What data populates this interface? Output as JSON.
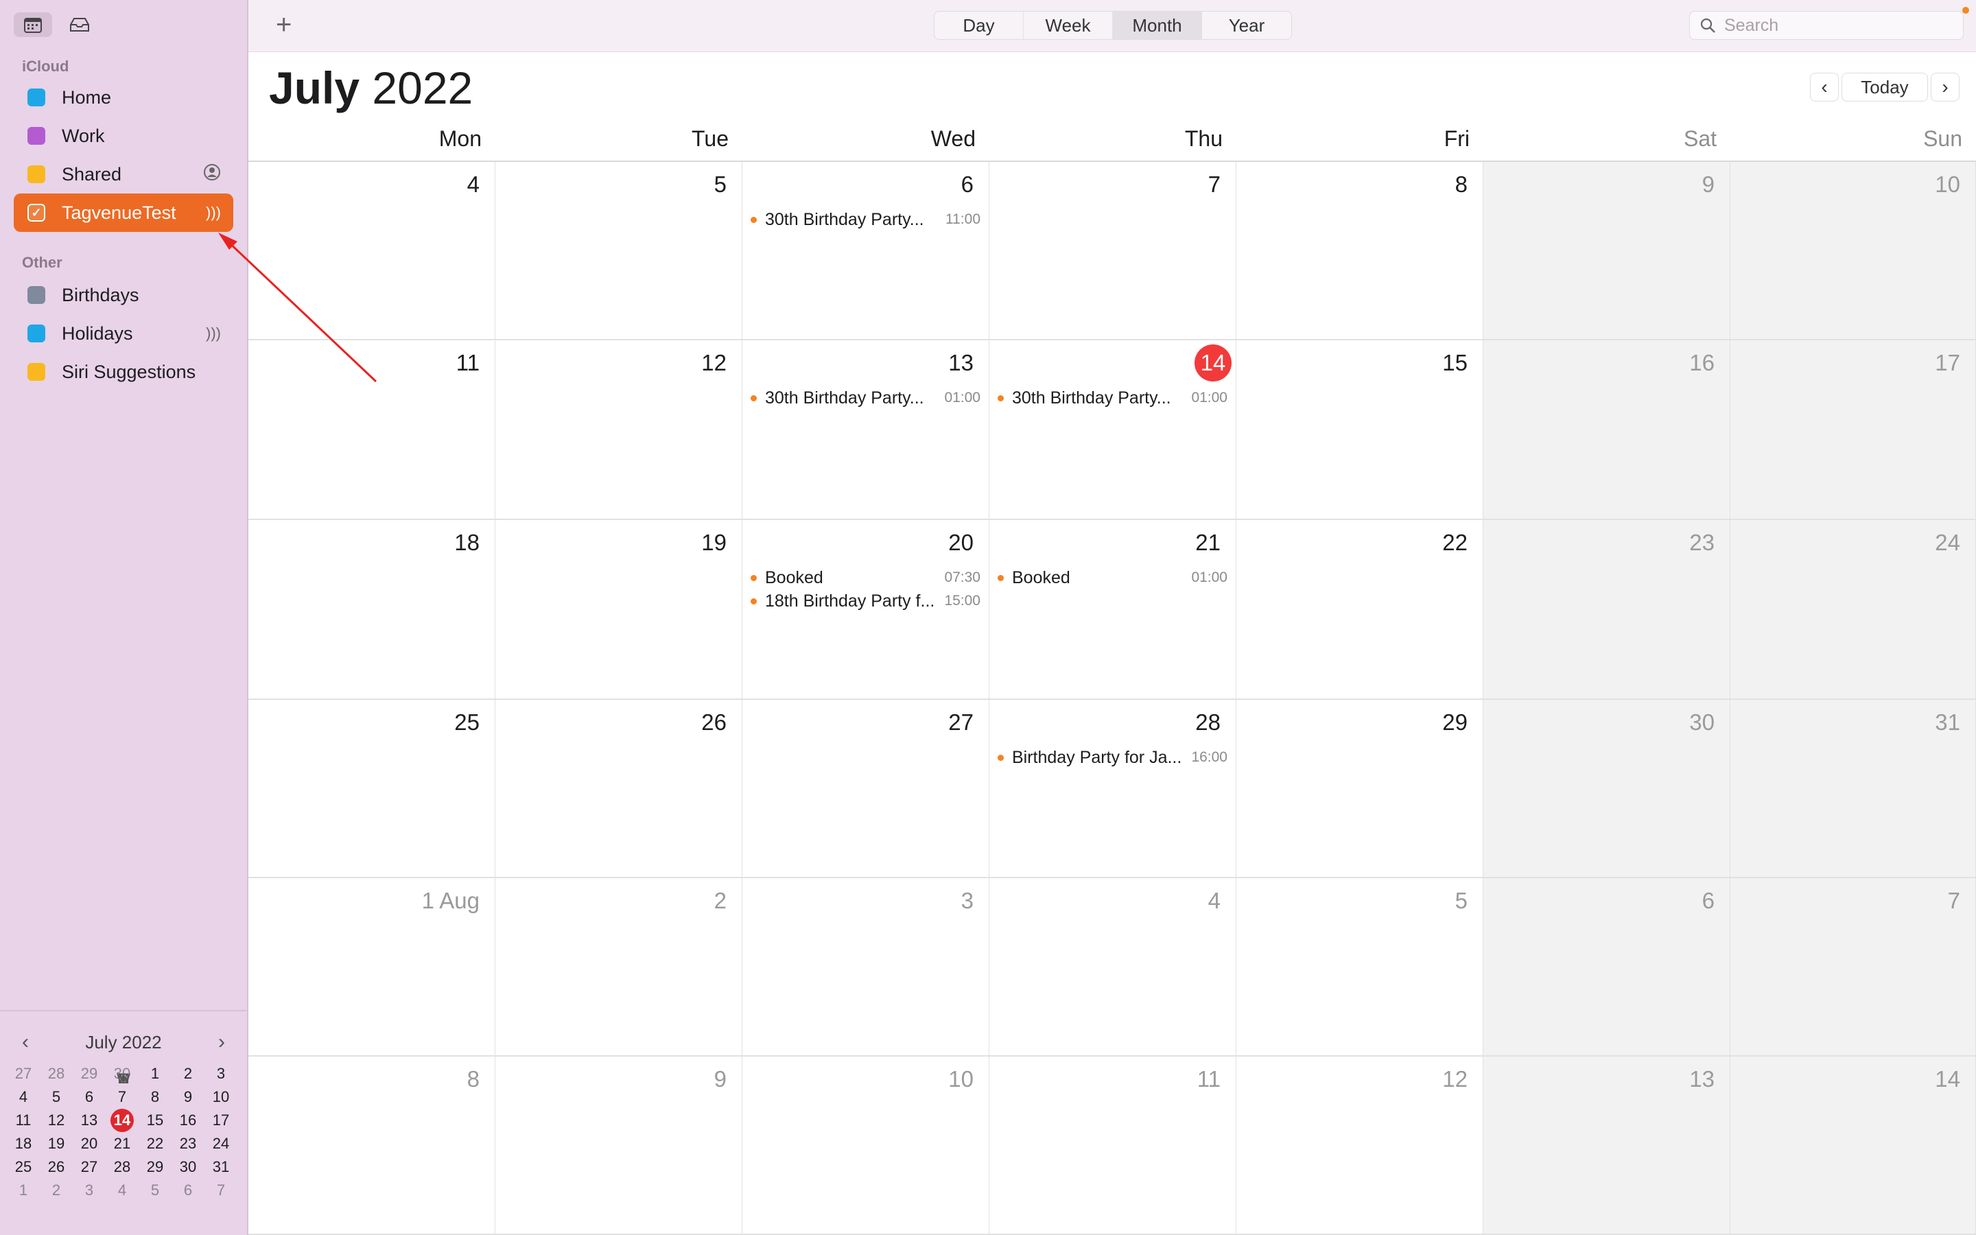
{
  "sidebar": {
    "icloud_label": "iCloud",
    "other_label": "Other",
    "icloud_items": [
      {
        "label": "Home",
        "color": "#1ea7e6",
        "trail": ""
      },
      {
        "label": "Work",
        "color": "#b55bd2",
        "trail": ""
      },
      {
        "label": "Shared",
        "color": "#f9b820",
        "trail": "person-circle-icon"
      },
      {
        "label": "TagvenueTest",
        "color": "#ec6a24",
        "trail": "subscribed-icon",
        "selected": true
      }
    ],
    "other_items": [
      {
        "label": "Birthdays",
        "color": "#7f8a9c"
      },
      {
        "label": "Holidays",
        "color": "#1ea7e6"
      },
      {
        "label": "Siri Suggestions",
        "color": "#f9b820"
      }
    ]
  },
  "mini_calendar": {
    "title": "July 2022",
    "dow": [
      "M",
      "T",
      "W",
      "T",
      "F",
      "S",
      "S"
    ],
    "weeks": [
      [
        "27",
        "28",
        "29",
        "30",
        "1",
        "2",
        "3"
      ],
      [
        "4",
        "5",
        "6",
        "7",
        "8",
        "9",
        "10"
      ],
      [
        "11",
        "12",
        "13",
        "14",
        "15",
        "16",
        "17"
      ],
      [
        "18",
        "19",
        "20",
        "21",
        "22",
        "23",
        "24"
      ],
      [
        "25",
        "26",
        "27",
        "28",
        "29",
        "30",
        "31"
      ],
      [
        "1",
        "2",
        "3",
        "4",
        "5",
        "6",
        "7"
      ]
    ],
    "today": "14"
  },
  "toolbar": {
    "add_label": "+",
    "views": [
      "Day",
      "Week",
      "Month",
      "Year"
    ],
    "active_view": "Month",
    "search_placeholder": "Search"
  },
  "header": {
    "month": "July",
    "year": "2022",
    "today_label": "Today",
    "prev_label": "‹",
    "next_label": "›"
  },
  "dow_headers": [
    "Mon",
    "Tue",
    "Wed",
    "Thu",
    "Fri",
    "Sat",
    "Sun"
  ],
  "weeks": [
    {
      "days": [
        "4",
        "5",
        "6",
        "7",
        "8",
        "9",
        "10"
      ]
    },
    {
      "days": [
        "11",
        "12",
        "13",
        "14",
        "15",
        "16",
        "17"
      ]
    },
    {
      "days": [
        "18",
        "19",
        "20",
        "21",
        "22",
        "23",
        "24"
      ]
    },
    {
      "days": [
        "25",
        "26",
        "27",
        "28",
        "29",
        "30",
        "31"
      ]
    },
    {
      "days": [
        "1 Aug",
        "2",
        "3",
        "4",
        "5",
        "6",
        "7"
      ],
      "other_month": true
    },
    {
      "days": [
        "8",
        "9",
        "10",
        "11",
        "12",
        "13",
        "14"
      ],
      "other_month": true
    }
  ],
  "today_date": "14",
  "events": [
    {
      "week": 0,
      "day": 2,
      "title": "30th Birthday Party...",
      "time": "11:00"
    },
    {
      "week": 1,
      "day": 2,
      "title": "30th Birthday Party...",
      "time": "01:00"
    },
    {
      "week": 1,
      "day": 3,
      "title": "30th Birthday Party...",
      "time": "01:00"
    },
    {
      "week": 2,
      "day": 2,
      "title": "Booked",
      "time": "07:30"
    },
    {
      "week": 2,
      "day": 2,
      "title": "18th Birthday Party f...",
      "time": "15:00"
    },
    {
      "week": 2,
      "day": 3,
      "title": "Booked",
      "time": "01:00"
    },
    {
      "week": 3,
      "day": 3,
      "title": "Birthday Party for Ja...",
      "time": "16:00"
    }
  ],
  "colors": {
    "accent": "#ec6a24",
    "event_dot": "#f5821f",
    "today_red": "#f23a3a",
    "annotation_arrow": "#e8231f"
  }
}
